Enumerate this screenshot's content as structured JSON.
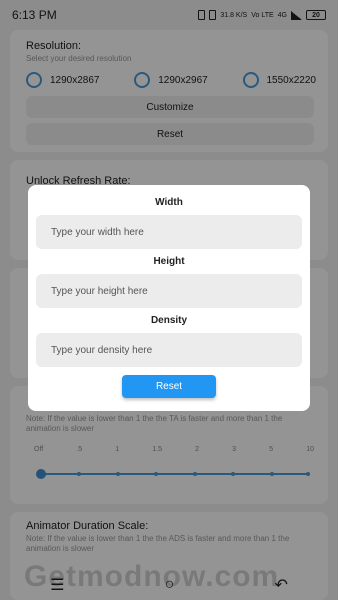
{
  "status_bar": {
    "time": "6:13 PM",
    "speed": "31.8 K/S",
    "network": "Vo LTE",
    "signal": "4G",
    "battery": "20"
  },
  "resolution_card": {
    "title": "Resolution:",
    "subtitle": "Select your desired resolution",
    "options": [
      "1290x2867",
      "1290x2967",
      "1550x2220"
    ],
    "customize_label": "Customize",
    "reset_label": "Reset"
  },
  "refresh_card": {
    "title": "Unlock Refresh Rate:"
  },
  "transition_card": {
    "subtitle": "Note: If the value is lower than 1 the the TA is faster and more than 1 the animation is slower",
    "ticks": [
      "Off",
      ".5",
      "1",
      "1.5",
      "2",
      "3",
      "5",
      "10"
    ],
    "value": 0
  },
  "animator_card": {
    "title": "Animator Duration Scale:",
    "subtitle": "Note: If the value is lower than 1 the the ADS is faster and more than 1 the animation is slower"
  },
  "dialog": {
    "width_label": "Width",
    "width_placeholder": "Type your width here",
    "height_label": "Height",
    "height_placeholder": "Type your height here",
    "density_label": "Density",
    "density_placeholder": "Type your density here",
    "reset_label": "Reset"
  },
  "nav_bar": {
    "menu_icon": "menu-icon",
    "home_icon": "home-icon",
    "back_icon": "back-icon"
  },
  "watermark": "Getmodnow.com",
  "colors": {
    "accent": "#2196f3",
    "radio": "#4a9ad6",
    "overlay": "rgba(0,0,0,0.42)"
  }
}
